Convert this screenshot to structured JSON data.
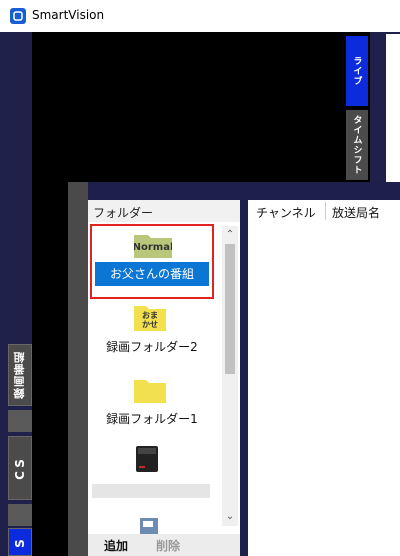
{
  "window": {
    "title": "SmartVision"
  },
  "left_tabs": [
    {
      "label": "録画番組"
    },
    {
      "label": "CS"
    },
    {
      "label": "S"
    }
  ],
  "side_tabs": [
    {
      "label": "ライブ"
    },
    {
      "label": "タイムシフト"
    }
  ],
  "folders": {
    "header": "フォルダー",
    "items": [
      {
        "label": "お父さんの番組",
        "icon_text": "Normal",
        "selected": true
      },
      {
        "label": "録画フォルダー2",
        "icon_text": "おま\nかせ"
      },
      {
        "label": "録画フォルダー1"
      },
      {
        "label": ""
      }
    ]
  },
  "columns": [
    "チャンネル",
    "放送局名"
  ],
  "buttons": {
    "add": "追加",
    "delete": "削除"
  },
  "colors": {
    "accent": "#0b76d4",
    "highlight_box": "#e32222",
    "live_tab": "#0b2bdc"
  }
}
